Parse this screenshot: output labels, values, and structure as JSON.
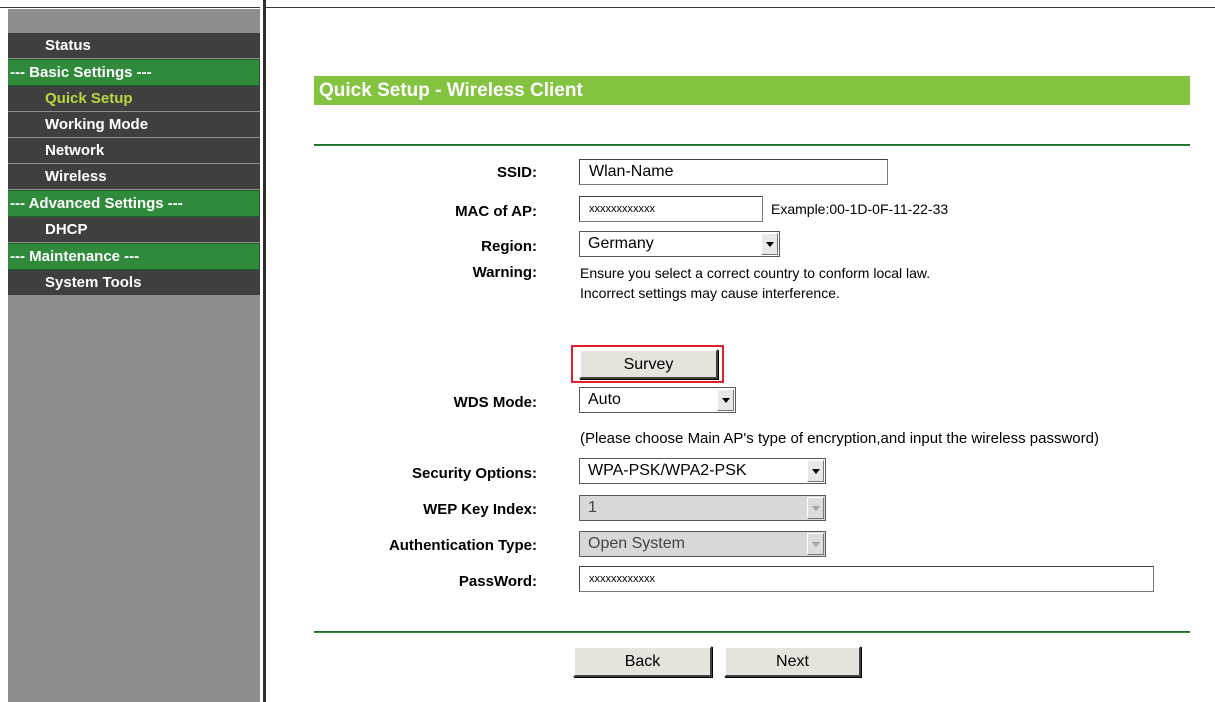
{
  "sidebar": {
    "items": [
      {
        "label": "Status",
        "type": "item"
      },
      {
        "label": "--- Basic Settings ---",
        "type": "header"
      },
      {
        "label": "Quick Setup",
        "type": "item",
        "active": true
      },
      {
        "label": "Working Mode",
        "type": "item"
      },
      {
        "label": "Network",
        "type": "item"
      },
      {
        "label": "Wireless",
        "type": "item"
      },
      {
        "label": "--- Advanced Settings ---",
        "type": "header"
      },
      {
        "label": "DHCP",
        "type": "item"
      },
      {
        "label": "--- Maintenance ---",
        "type": "header"
      },
      {
        "label": "System Tools",
        "type": "item"
      }
    ]
  },
  "main": {
    "title": "Quick Setup - Wireless Client",
    "form": {
      "ssid_label": "SSID:",
      "ssid_value": "Wlan-Name",
      "mac_label": "MAC of AP:",
      "mac_value": "xxxxxxxxxxxx",
      "mac_example": "Example:00-1D-0F-11-22-33",
      "region_label": "Region:",
      "region_value": "Germany",
      "warning_label": "Warning:",
      "warning_line1": "Ensure you select a correct country to conform local law.",
      "warning_line2": "Incorrect settings may cause interference.",
      "survey_button": "Survey",
      "wds_label": "WDS Mode:",
      "wds_value": "Auto",
      "encryption_note": "(Please choose Main AP's type of encryption,and input the wireless password)",
      "security_label": "Security Options:",
      "security_value": "WPA-PSK/WPA2-PSK",
      "wep_label": "WEP Key Index:",
      "wep_value": "1",
      "auth_label": "Authentication Type:",
      "auth_value": "Open System",
      "password_label": "PassWord:",
      "password_value": "xxxxxxxxxxxx"
    },
    "buttons": {
      "back": "Back",
      "next": "Next"
    }
  },
  "colors": {
    "title_bar": "#84c33f",
    "section_header": "#2f8a3c",
    "menu_bg": "#3f3f3f",
    "menu_active_text": "#b6d93f",
    "highlight_box": "#e0202a"
  }
}
